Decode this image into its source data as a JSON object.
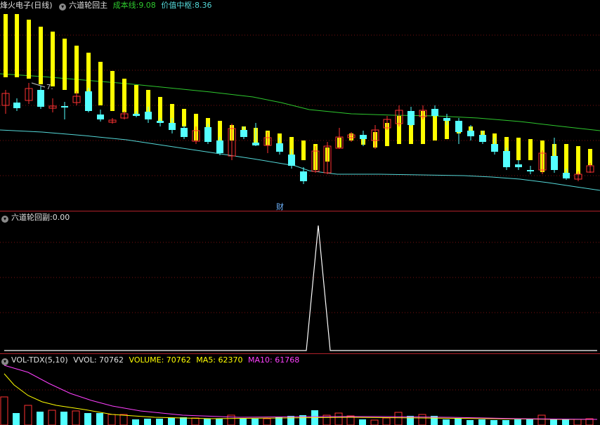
{
  "main_header": {
    "stock": "烽火电子",
    "period": "(日线)",
    "indicator": "六道轮回主",
    "cost_label": "成本线:",
    "cost_value": "9.08",
    "center_label": "价值中枢:",
    "center_value": "8.36"
  },
  "price_annotation": "7.",
  "finance_badge": "财",
  "sub_header": {
    "indicator": "六道轮回副",
    "value_text": ":0.00"
  },
  "vol_header": {
    "indicator": "VOL-TDX(5,10)",
    "vvol": "VVOL: 70762",
    "volume": "VOLUME: 70762",
    "ma5": "MA5: 62370",
    "ma10": "MA10: 61768"
  },
  "colors": {
    "up": "#ff3232",
    "down": "#54ffff",
    "signal_bar": "#ffff00",
    "cost_line": "#2ec82e",
    "center_line": "#54d8d8",
    "ma5": "#ffff00",
    "ma10": "#ff40ff",
    "spike": "#ffffff"
  },
  "icons": [
    "collapse-circle-icon"
  ]
}
